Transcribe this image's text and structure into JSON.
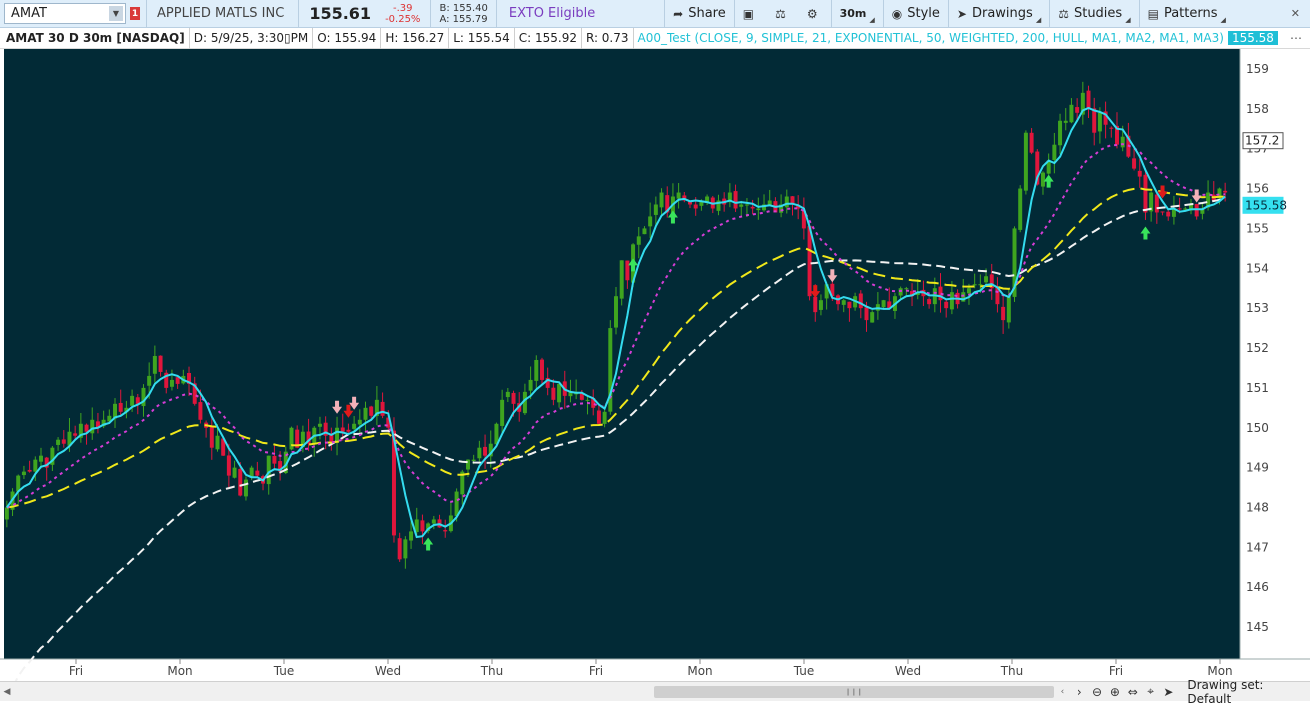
{
  "topbar": {
    "symbol": "AMAT",
    "alert_count": "1",
    "company": "APPLIED MATLS INC",
    "last_price": "155.61",
    "change": "-.39",
    "change_pct": "-0.25%",
    "bid": "B: 155.40",
    "ask": "A: 155.79",
    "exto": "EXTO Eligible",
    "share": "Share",
    "timeframe": "30m",
    "style": "Style",
    "drawings": "Drawings",
    "studies": "Studies",
    "patterns": "Patterns"
  },
  "infobar": {
    "title": "AMAT 30 D 30m [NASDAQ]",
    "date": "D: 5/9/25, 3:30▯PM",
    "open": "O: 155.94",
    "high": "H: 156.27",
    "low": "L: 155.54",
    "close": "C: 155.92",
    "range": "R: 0.73",
    "study": "A00_Test (CLOSE, 9, SIMPLE, 21, EXPONENTIAL, 50, WEIGHTED, 200, HULL, MA1, MA2, MA1, MA3)",
    "study_value": "155.58"
  },
  "footer": {
    "drawing_set": "Drawing set: Default"
  },
  "chart_data": {
    "type": "candlestick",
    "symbol": "AMAT",
    "interval": "30m",
    "ylim": [
      144.2,
      159.5
    ],
    "yticks": [
      145,
      146,
      147,
      148,
      149,
      150,
      151,
      152,
      153,
      154,
      155,
      156,
      157,
      158,
      159
    ],
    "xticks": [
      "Fri",
      "Mon",
      "Tue",
      "Wed",
      "Thu",
      "Fri",
      "Mon",
      "Tue",
      "Wed",
      "Thu",
      "Fri",
      "Mon"
    ],
    "price_labels": [
      {
        "value": 157.2,
        "text": "157.2",
        "color": "#ffffff"
      },
      {
        "value": 155.58,
        "text": "155.58",
        "color": "#35e0f0"
      }
    ],
    "colors": {
      "background": "#022a36",
      "up_candle": "#3fa51f",
      "down_candle": "#e0163c",
      "ma_fast": "#34dcef",
      "ma_mid": "#d53dd5",
      "ma_slow": "#f0e81a",
      "ma_long": "#f2f2f2",
      "arrow_up": "#39e45b",
      "arrow_down_dark": "#e01a1a",
      "arrow_down_light": "#f2b1b9"
    },
    "closes": [
      148.0,
      148.4,
      148.8,
      148.9,
      148.9,
      149.2,
      149.3,
      149.0,
      149.5,
      149.7,
      149.6,
      149.9,
      149.8,
      150.1,
      149.9,
      150.2,
      150.0,
      150.2,
      150.3,
      150.6,
      150.4,
      150.5,
      150.8,
      150.6,
      151.0,
      151.3,
      151.8,
      151.4,
      151.0,
      151.2,
      151.1,
      151.3,
      151.1,
      150.6,
      150.2,
      150.0,
      149.5,
      149.8,
      149.3,
      148.8,
      149.0,
      148.3,
      148.7,
      149.0,
      148.8,
      148.6,
      149.3,
      149.1,
      148.9,
      149.4,
      150.0,
      149.5,
      149.9,
      149.6,
      150.0,
      150.1,
      149.8,
      149.6,
      150.0,
      149.9,
      149.9,
      150.1,
      150.2,
      150.5,
      150.3,
      150.7,
      150.3,
      150.0,
      147.3,
      146.7,
      147.2,
      147.4,
      147.7,
      147.4,
      147.6,
      147.7,
      147.5,
      147.4,
      147.8,
      148.4,
      148.9,
      149.2,
      149.2,
      149.5,
      149.3,
      149.6,
      150.1,
      150.7,
      150.9,
      150.6,
      150.4,
      150.9,
      151.2,
      151.7,
      151.2,
      151.0,
      150.7,
      151.1,
      150.8,
      150.9,
      150.9,
      150.7,
      150.7,
      150.5,
      150.1,
      150.4,
      152.5,
      153.3,
      154.2,
      153.7,
      154.6,
      154.8,
      155.0,
      155.3,
      155.6,
      155.9,
      155.4,
      155.8,
      155.9,
      155.7,
      155.6,
      155.5,
      155.7,
      155.8,
      155.5,
      155.7,
      155.6,
      155.9,
      155.5,
      155.6,
      155.6,
      155.5,
      155.5,
      155.6,
      155.7,
      155.4,
      155.6,
      155.8,
      155.6,
      155.5,
      155.0,
      153.3,
      152.9,
      153.2,
      153.6,
      153.3,
      153.1,
      153.2,
      153.0,
      153.3,
      153.0,
      152.7,
      152.9,
      153.1,
      153.2,
      153.0,
      153.3,
      153.5,
      153.5,
      153.3,
      153.4,
      153.3,
      153.1,
      153.5,
      153.2,
      153.0,
      153.4,
      153.1,
      153.4,
      153.5,
      153.6,
      153.6,
      153.8,
      153.5,
      153.1,
      152.7,
      153.3,
      155.0,
      156.0,
      157.4,
      156.9,
      156.1,
      156.4,
      156.7,
      157.1,
      157.7,
      157.7,
      158.1,
      157.9,
      158.4,
      158.0,
      157.4,
      157.9,
      157.6,
      157.5,
      157.1,
      157.3,
      156.8,
      156.5,
      156.3,
      155.4,
      155.9,
      155.4,
      155.4,
      155.3,
      155.5,
      155.5,
      155.5,
      155.6,
      155.3,
      155.5,
      155.9,
      155.7,
      156.0,
      155.9
    ]
  }
}
